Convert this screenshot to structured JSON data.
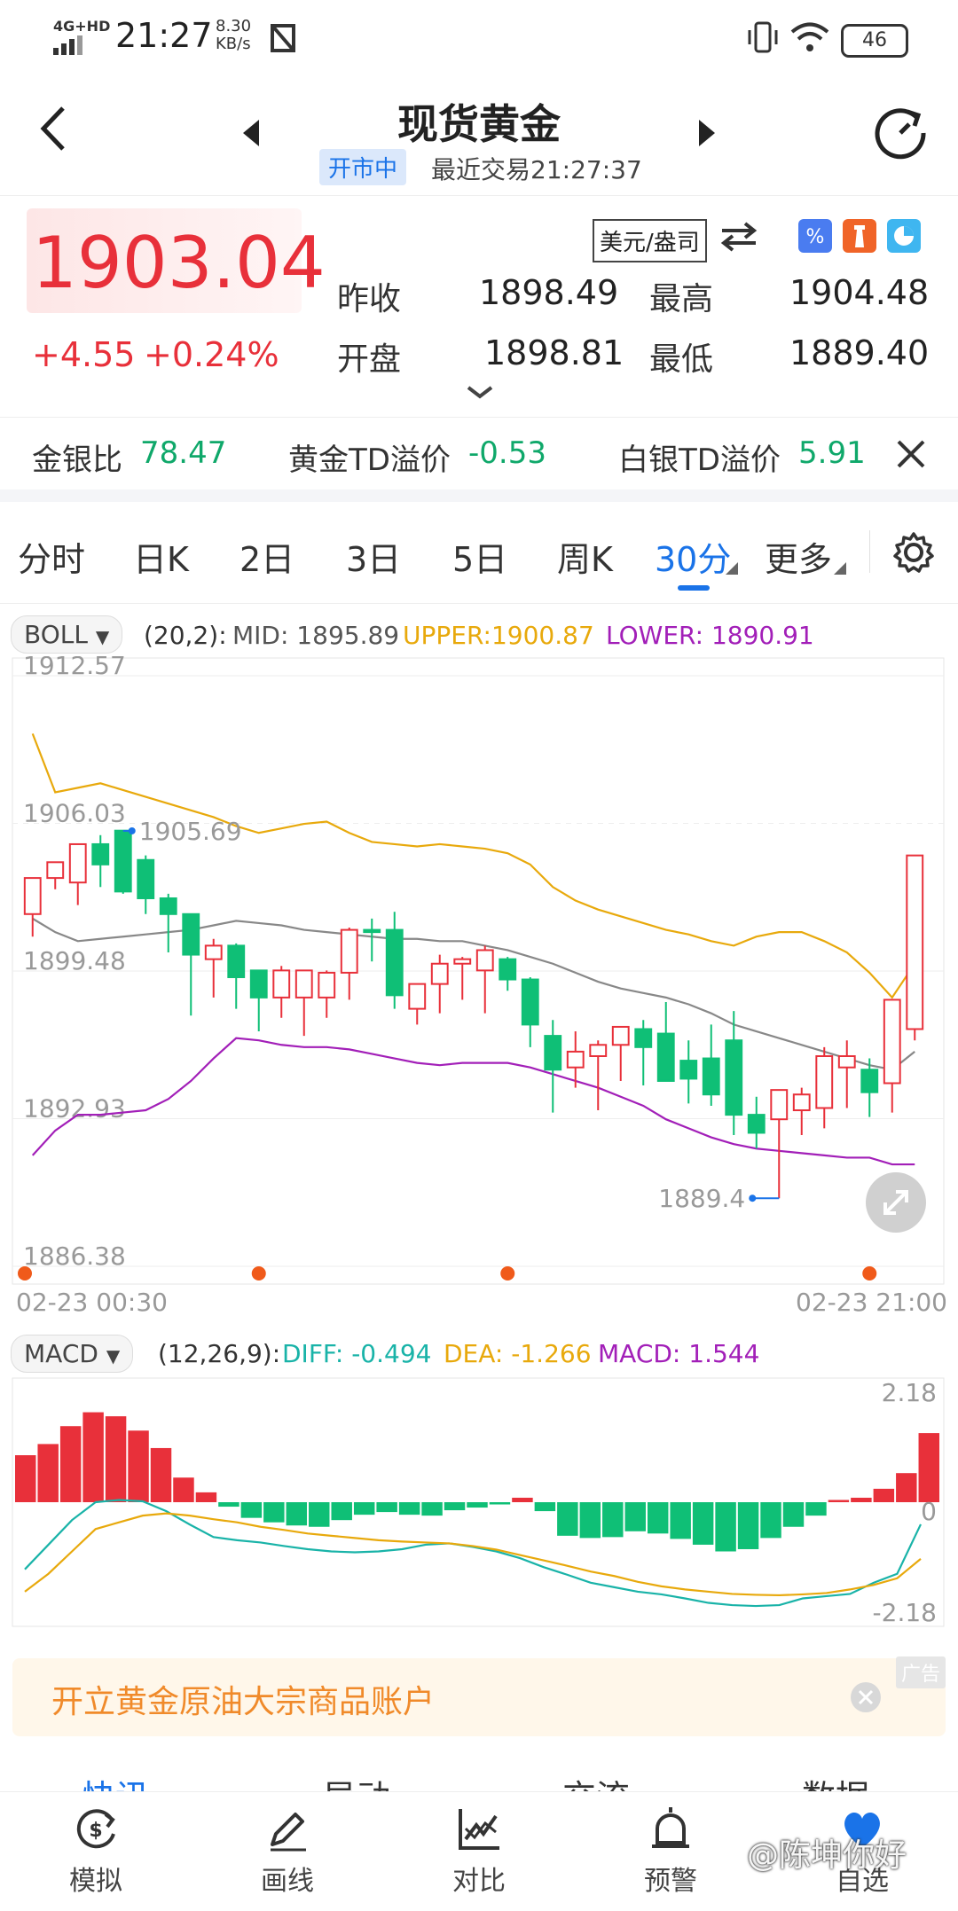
{
  "status_bar": {
    "network": "4G+HD",
    "time": "21:27",
    "speed_value": "8.30",
    "speed_unit": "KB/s",
    "battery": "46"
  },
  "header": {
    "title": "现货黄金",
    "market_status": "开市中",
    "last_trade": "最近交易21:27:37"
  },
  "quote": {
    "price": "1903.04",
    "change": "+4.55",
    "change_pct": "+0.24%",
    "unit_selector": "美元/盎司",
    "prev_close_label": "昨收",
    "prev_close": "1898.49",
    "high_label": "最高",
    "high": "1904.48",
    "open_label": "开盘",
    "open": "1898.81",
    "low_label": "最低",
    "low": "1889.40"
  },
  "ratios": {
    "gold_silver_label": "金银比",
    "gold_silver": "78.47",
    "gold_td_label": "黄金TD溢价",
    "gold_td": "-0.53",
    "silver_td_label": "白银TD溢价",
    "silver_td": "5.91"
  },
  "tabs": {
    "items": [
      "分时",
      "日K",
      "2日",
      "3日",
      "5日",
      "周K",
      "30分",
      "更多"
    ],
    "active": "30分"
  },
  "boll": {
    "selector": "BOLL",
    "params": "(20,2):",
    "mid": "MID: 1895.89",
    "upper": "UPPER:1900.87",
    "lower": "LOWER: 1890.91",
    "y_labels": [
      "1912.57",
      "1906.03",
      "1899.48",
      "1892.93",
      "1886.38"
    ],
    "max_label": "1905.69",
    "min_label": "1889.4",
    "x_start": "02-23 00:30",
    "x_end": "02-23 21:00"
  },
  "macd": {
    "selector": "MACD",
    "params": "(12,26,9):",
    "diff": "DIFF: -0.494",
    "dea": "DEA: -1.266",
    "macd": "MACD: 1.544",
    "y_top": "2.18",
    "y_mid": "0",
    "y_bottom": "-2.18"
  },
  "ad": {
    "text": "开立黄金原油大宗商品账户",
    "tag": "广告"
  },
  "section_tabs": [
    "快讯",
    "异动",
    "交流",
    "数据"
  ],
  "bottom_nav": {
    "items": [
      {
        "label": "模拟",
        "icon": "simulate-icon"
      },
      {
        "label": "画线",
        "icon": "draw-icon"
      },
      {
        "label": "对比",
        "icon": "compare-icon"
      },
      {
        "label": "预警",
        "icon": "alarm-icon"
      },
      {
        "label": "自选",
        "icon": "heart-icon"
      }
    ],
    "watermark": "@陈坤你好"
  },
  "colors": {
    "up": "#e8303a",
    "down": "#0fbf76",
    "accent": "#1a73e8",
    "boll_upper": "#e8a90c",
    "boll_lower": "#a21fb8",
    "boll_mid": "#888888",
    "diff": "#19b3a8",
    "dea": "#e8a90c"
  },
  "chart_data": [
    {
      "type": "candlestick",
      "title": "",
      "ylim": [
        1886.38,
        1912.57
      ],
      "series": [
        {
          "name": "UPPER",
          "values": [
            1910.0,
            1907.4,
            1907.6,
            1907.8,
            1907.5,
            1907.2,
            1906.9,
            1906.6,
            1906.3,
            1905.9,
            1905.6,
            1905.8,
            1906.0,
            1906.1,
            1905.6,
            1905.2,
            1905.1,
            1905.0,
            1905.1,
            1905.0,
            1904.9,
            1904.7,
            1904.2,
            1903.2,
            1902.6,
            1902.2,
            1901.9,
            1901.6,
            1901.3,
            1901.1,
            1900.8,
            1900.6,
            1901.0,
            1901.2,
            1901.2,
            1900.8,
            1900.3,
            1899.4,
            1898.3,
            1899.8
          ]
        },
        {
          "name": "MID",
          "values": [
            1901.8,
            1901.2,
            1900.8,
            1900.9,
            1901.0,
            1901.1,
            1901.2,
            1901.3,
            1901.5,
            1901.7,
            1901.6,
            1901.5,
            1901.3,
            1901.2,
            1901.1,
            1901.0,
            1900.9,
            1900.9,
            1900.8,
            1900.8,
            1900.6,
            1900.4,
            1900.1,
            1899.8,
            1899.4,
            1899.0,
            1898.7,
            1898.5,
            1898.3,
            1898.0,
            1897.6,
            1897.1,
            1896.8,
            1896.5,
            1896.2,
            1895.9,
            1895.6,
            1895.3,
            1895.1,
            1895.9
          ]
        },
        {
          "name": "LOWER",
          "values": [
            1891.3,
            1892.4,
            1893.1,
            1893.1,
            1893.2,
            1893.3,
            1893.8,
            1894.6,
            1895.6,
            1896.5,
            1896.4,
            1896.2,
            1896.1,
            1896.1,
            1896.0,
            1895.8,
            1895.6,
            1895.4,
            1895.3,
            1895.4,
            1895.4,
            1895.4,
            1895.2,
            1894.9,
            1894.6,
            1894.3,
            1893.9,
            1893.5,
            1892.9,
            1892.5,
            1892.1,
            1891.8,
            1891.6,
            1891.5,
            1891.4,
            1891.3,
            1891.2,
            1891.2,
            1890.9,
            1890.9
          ]
        },
        {
          "name": "OHLC",
          "values": [
            [
              1902.0,
              1903.3,
              1901.0,
              1903.6
            ],
            [
              1903.6,
              1903.8,
              1903.1,
              1904.3
            ],
            [
              1903.4,
              1904.8,
              1902.4,
              1905.1
            ],
            [
              1905.1,
              1905.5,
              1903.2,
              1904.2
            ],
            [
              1905.7,
              1905.7,
              1902.9,
              1903.0
            ],
            [
              1904.4,
              1904.6,
              1902.0,
              1902.7
            ],
            [
              1902.7,
              1902.9,
              1900.3,
              1902.0
            ],
            [
              1902.0,
              1902.0,
              1897.5,
              1900.2
            ],
            [
              1900.0,
              1900.9,
              1898.3,
              1900.6
            ],
            [
              1900.6,
              1900.7,
              1897.8,
              1899.2
            ],
            [
              1899.5,
              1899.5,
              1896.8,
              1898.3
            ],
            [
              1898.3,
              1899.7,
              1897.4,
              1899.5
            ],
            [
              1898.3,
              1899.5,
              1896.6,
              1899.5
            ],
            [
              1898.3,
              1899.5,
              1897.4,
              1899.4
            ],
            [
              1899.4,
              1901.4,
              1898.2,
              1901.3
            ],
            [
              1901.3,
              1901.8,
              1899.9,
              1901.2
            ],
            [
              1901.3,
              1902.1,
              1897.8,
              1898.4
            ],
            [
              1897.8,
              1898.7,
              1897.1,
              1898.9
            ],
            [
              1898.9,
              1900.2,
              1897.6,
              1899.8
            ],
            [
              1899.8,
              1900.1,
              1898.2,
              1900.0
            ],
            [
              1899.5,
              1900.6,
              1897.6,
              1900.4
            ],
            [
              1900.0,
              1900.1,
              1898.6,
              1899.1
            ],
            [
              1899.1,
              1899.2,
              1896.1,
              1897.1
            ],
            [
              1896.6,
              1897.3,
              1893.2,
              1895.1
            ],
            [
              1895.2,
              1896.8,
              1894.3,
              1895.9
            ],
            [
              1895.7,
              1896.4,
              1893.3,
              1896.2
            ],
            [
              1896.2,
              1896.9,
              1894.6,
              1897.0
            ],
            [
              1896.9,
              1897.3,
              1894.4,
              1896.1
            ],
            [
              1896.7,
              1898.1,
              1894.9,
              1894.6
            ],
            [
              1895.5,
              1896.4,
              1893.6,
              1894.7
            ],
            [
              1895.6,
              1897.1,
              1893.5,
              1894.0
            ],
            [
              1896.4,
              1897.7,
              1892.2,
              1893.1
            ],
            [
              1893.1,
              1893.9,
              1891.6,
              1892.3
            ],
            [
              1892.9,
              1892.9,
              1889.4,
              1894.2
            ],
            [
              1893.3,
              1894.3,
              1892.2,
              1894.0
            ],
            [
              1893.4,
              1896.1,
              1892.5,
              1895.7
            ],
            [
              1895.2,
              1896.4,
              1893.4,
              1895.7
            ],
            [
              1895.1,
              1895.6,
              1893.0,
              1894.1
            ],
            [
              1894.5,
              1895.8,
              1893.2,
              1898.2
            ],
            [
              1896.9,
              1904.5,
              1896.4,
              1904.6
            ]
          ]
        }
      ]
    },
    {
      "type": "bar",
      "title": "",
      "ylim": [
        -2.18,
        2.18
      ],
      "series": [
        {
          "name": "MACD",
          "values": [
            1.05,
            1.3,
            1.7,
            2.01,
            1.92,
            1.6,
            1.21,
            0.55,
            0.22,
            -0.1,
            -0.35,
            -0.45,
            -0.52,
            -0.55,
            -0.4,
            -0.28,
            -0.22,
            -0.28,
            -0.3,
            -0.18,
            -0.12,
            -0.05,
            0.1,
            -0.2,
            -0.75,
            -0.8,
            -0.78,
            -0.65,
            -0.7,
            -0.82,
            -0.95,
            -1.1,
            -1.05,
            -0.8,
            -0.55,
            -0.3,
            0.05,
            0.1,
            0.3,
            0.65,
            1.544
          ]
        },
        {
          "name": "DIFF",
          "values": [
            -1.5,
            -0.95,
            -0.4,
            0.0,
            0.05,
            0.02,
            -0.2,
            -0.5,
            -0.78,
            -0.85,
            -0.9,
            -0.98,
            -1.05,
            -1.1,
            -1.12,
            -1.1,
            -1.05,
            -0.95,
            -0.92,
            -1.0,
            -1.1,
            -1.25,
            -1.45,
            -1.62,
            -1.8,
            -1.9,
            -2.0,
            -2.06,
            -2.15,
            -2.25,
            -2.3,
            -2.32,
            -2.3,
            -2.15,
            -2.1,
            -2.05,
            -1.8,
            -1.6,
            -0.494
          ]
        },
        {
          "name": "DEA",
          "values": [
            -2.0,
            -1.6,
            -1.1,
            -0.6,
            -0.45,
            -0.3,
            -0.25,
            -0.3,
            -0.38,
            -0.45,
            -0.55,
            -0.62,
            -0.7,
            -0.75,
            -0.8,
            -0.85,
            -0.88,
            -0.9,
            -0.92,
            -0.98,
            -1.06,
            -1.18,
            -1.3,
            -1.42,
            -1.55,
            -1.65,
            -1.78,
            -1.88,
            -1.95,
            -2.0,
            -2.05,
            -2.07,
            -2.08,
            -2.06,
            -2.03,
            -1.95,
            -1.85,
            -1.7,
            -1.266
          ]
        }
      ]
    }
  ]
}
